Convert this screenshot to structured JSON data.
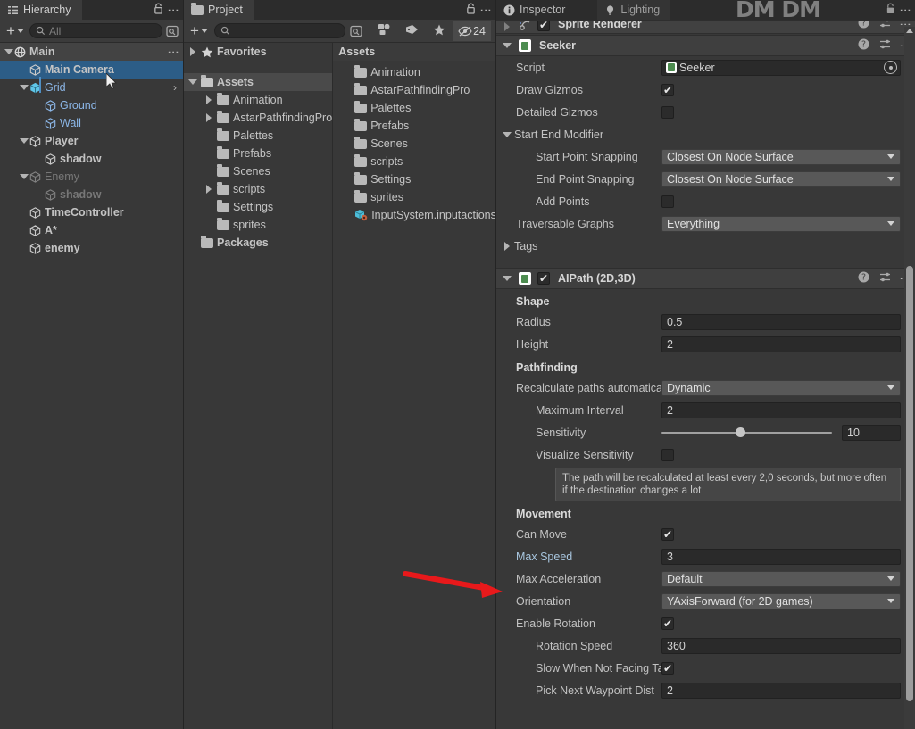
{
  "hierarchy": {
    "tab": {
      "label": "Hierarchy",
      "icon": "hierarchy-icon"
    },
    "toolbar": {
      "add_label": "+",
      "search_placeholder": "All",
      "search_value": ""
    },
    "items": [
      {
        "label": "Main",
        "indent": 0,
        "fold": "open",
        "icon": "scene-icon",
        "state": "scene",
        "selected": false,
        "kebab": true
      },
      {
        "label": "Main Camera",
        "indent": 1,
        "fold": "none",
        "icon": "cube-icon",
        "state": "normal",
        "selected": true,
        "kebab": false
      },
      {
        "label": "Grid",
        "indent": 1,
        "fold": "open",
        "icon": "prefab-icon",
        "state": "prefab",
        "selected": false,
        "kebab": false,
        "chevron": true
      },
      {
        "label": "Ground",
        "indent": 2,
        "fold": "none",
        "icon": "cube-icon",
        "state": "prefab",
        "selected": false,
        "kebab": false
      },
      {
        "label": "Wall",
        "indent": 2,
        "fold": "none",
        "icon": "cube-icon",
        "state": "prefab",
        "selected": false,
        "kebab": false
      },
      {
        "label": "Player",
        "indent": 1,
        "fold": "open",
        "icon": "cube-icon",
        "state": "normal",
        "selected": false,
        "kebab": false
      },
      {
        "label": "shadow",
        "indent": 2,
        "fold": "none",
        "icon": "cube-icon",
        "state": "normal",
        "selected": false,
        "kebab": false
      },
      {
        "label": "Enemy",
        "indent": 1,
        "fold": "open",
        "icon": "cube-icon",
        "state": "inactive",
        "selected": false,
        "kebab": false
      },
      {
        "label": "shadow",
        "indent": 2,
        "fold": "none",
        "icon": "cube-icon",
        "state": "inactive",
        "selected": false,
        "kebab": false
      },
      {
        "label": "TimeController",
        "indent": 1,
        "fold": "none",
        "icon": "cube-icon",
        "state": "normal",
        "selected": false,
        "kebab": false
      },
      {
        "label": "A*",
        "indent": 1,
        "fold": "none",
        "icon": "cube-icon",
        "state": "normal",
        "selected": false,
        "kebab": false
      },
      {
        "label": "enemy",
        "indent": 1,
        "fold": "none",
        "icon": "cube-icon",
        "state": "normal",
        "selected": false,
        "kebab": false
      }
    ]
  },
  "project": {
    "tab": {
      "label": "Project",
      "icon": "folder-icon"
    },
    "toolbar": {
      "add_label": "+",
      "search_placeholder": "",
      "search_value": "",
      "buttons": [
        {
          "name": "asset-filter-icon",
          "label": ""
        },
        {
          "name": "label-filter-icon",
          "label": ""
        },
        {
          "name": "favorite-filter-icon",
          "label": ""
        }
      ],
      "hidden_count": "24",
      "hidden_icon": "eye-off-icon"
    },
    "tree": [
      {
        "label": "Favorites",
        "indent": 0,
        "fold": "closed",
        "icon": "star-icon",
        "bold": true,
        "selected": false
      },
      {
        "label": "",
        "indent": 0,
        "fold": "none",
        "icon": "spacer",
        "bold": false,
        "selected": false
      },
      {
        "label": "Assets",
        "indent": 0,
        "fold": "open",
        "icon": "folder-open-icon",
        "bold": true,
        "selected": true
      },
      {
        "label": "Animation",
        "indent": 1,
        "fold": "closed",
        "icon": "folder-icon",
        "bold": false,
        "selected": false
      },
      {
        "label": "AstarPathfindingPro",
        "indent": 1,
        "fold": "closed",
        "icon": "folder-icon",
        "bold": false,
        "selected": false
      },
      {
        "label": "Palettes",
        "indent": 1,
        "fold": "none",
        "icon": "folder-icon",
        "bold": false,
        "selected": false
      },
      {
        "label": "Prefabs",
        "indent": 1,
        "fold": "none",
        "icon": "folder-icon",
        "bold": false,
        "selected": false
      },
      {
        "label": "Scenes",
        "indent": 1,
        "fold": "none",
        "icon": "folder-icon",
        "bold": false,
        "selected": false
      },
      {
        "label": "scripts",
        "indent": 1,
        "fold": "closed",
        "icon": "folder-icon",
        "bold": false,
        "selected": false
      },
      {
        "label": "Settings",
        "indent": 1,
        "fold": "none",
        "icon": "folder-icon",
        "bold": false,
        "selected": false
      },
      {
        "label": "sprites",
        "indent": 1,
        "fold": "none",
        "icon": "folder-icon",
        "bold": false,
        "selected": false
      },
      {
        "label": "Packages",
        "indent": 0,
        "fold": "none",
        "icon": "folder-icon",
        "bold": true,
        "selected": false
      }
    ],
    "breadcrumb": "Assets",
    "contents": [
      {
        "label": "Animation",
        "icon": "folder-icon"
      },
      {
        "label": "AstarPathfindingPro",
        "icon": "folder-icon"
      },
      {
        "label": "Palettes",
        "icon": "folder-icon"
      },
      {
        "label": "Prefabs",
        "icon": "folder-icon"
      },
      {
        "label": "Scenes",
        "icon": "folder-icon"
      },
      {
        "label": "scripts",
        "icon": "folder-icon"
      },
      {
        "label": "Settings",
        "icon": "folder-icon"
      },
      {
        "label": "sprites",
        "icon": "folder-icon"
      },
      {
        "label": "InputSystem.inputactions",
        "icon": "inputactions-asset-icon"
      }
    ]
  },
  "inspector": {
    "tabs": [
      {
        "label": "Inspector",
        "icon": "info-icon",
        "active": true
      },
      {
        "label": "Lighting",
        "icon": "light-icon",
        "active": false
      }
    ],
    "watermark": "DM DM",
    "clipped_component": {
      "label": "Sprite Renderer",
      "enabled": true
    },
    "components": [
      {
        "name": "seeker-component",
        "title": "Seeker",
        "icon": "script-icon",
        "has_checkbox": false,
        "expanded": true,
        "rows": [
          {
            "kind": "object",
            "label": "Script",
            "value": "Seeker",
            "indent": 0
          },
          {
            "kind": "checkbox",
            "label": "Draw Gizmos",
            "value": true,
            "indent": 0
          },
          {
            "kind": "checkbox",
            "label": "Detailed Gizmos",
            "value": false,
            "indent": 0
          },
          {
            "kind": "foldout",
            "label": "Start End Modifier",
            "value": "open",
            "indent": 0
          },
          {
            "kind": "dropdown",
            "label": "Start Point Snapping",
            "value": "Closest On Node Surface",
            "indent": 1
          },
          {
            "kind": "dropdown",
            "label": "End Point Snapping",
            "value": "Closest On Node Surface",
            "indent": 1
          },
          {
            "kind": "checkbox",
            "label": "Add Points",
            "value": false,
            "indent": 1
          },
          {
            "kind": "dropdown",
            "label": "Traversable Graphs",
            "value": "Everything",
            "indent": 0
          },
          {
            "kind": "foldout",
            "label": "Tags",
            "value": "closed",
            "indent": 0
          }
        ]
      },
      {
        "name": "aipath-component",
        "title": "AIPath (2D,3D)",
        "icon": "script-icon",
        "has_checkbox": true,
        "checkbox_value": true,
        "expanded": true,
        "rows": [
          {
            "kind": "section",
            "label": "Shape"
          },
          {
            "kind": "text",
            "label": "Radius",
            "value": "0.5",
            "indent": 0
          },
          {
            "kind": "text",
            "label": "Height",
            "value": "2",
            "indent": 0
          },
          {
            "kind": "section",
            "label": "Pathfinding"
          },
          {
            "kind": "dropdown",
            "label": "Recalculate paths automatically",
            "value": "Dynamic",
            "indent": 0
          },
          {
            "kind": "text",
            "label": "Maximum Interval",
            "value": "2",
            "indent": 1
          },
          {
            "kind": "slider",
            "label": "Sensitivity",
            "value": "10",
            "indent": 1,
            "fraction": 0.46
          },
          {
            "kind": "checkbox",
            "label": "Visualize Sensitivity",
            "value": false,
            "indent": 1
          },
          {
            "kind": "help",
            "label": "The path will be recalculated at least every 2,0 seconds, but more often if the destination changes a lot"
          },
          {
            "kind": "section",
            "label": "Movement"
          },
          {
            "kind": "checkbox",
            "label": "Can Move",
            "value": true,
            "indent": 0
          },
          {
            "kind": "text",
            "label": "Max Speed",
            "value": "3",
            "indent": 0,
            "highlight": true
          },
          {
            "kind": "dropdown",
            "label": "Max Acceleration",
            "value": "Default",
            "indent": 0
          },
          {
            "kind": "dropdown",
            "label": "Orientation",
            "value": "YAxisForward (for 2D games)",
            "indent": 0
          },
          {
            "kind": "checkbox",
            "label": "Enable Rotation",
            "value": true,
            "indent": 0
          },
          {
            "kind": "text",
            "label": "Rotation Speed",
            "value": "360",
            "indent": 1
          },
          {
            "kind": "checkbox",
            "label": "Slow When Not Facing Target",
            "value": true,
            "indent": 1
          },
          {
            "kind": "text",
            "label": "Pick Next Waypoint Dist",
            "value": "2",
            "indent": 1
          }
        ]
      }
    ]
  },
  "annotation": {
    "name": "red-arrow",
    "color": "#e8191b",
    "points_to": "Max Speed"
  },
  "colors": {
    "panel_bg": "#383838",
    "tab_bg": "#2c2c2c",
    "selection_blue": "#2c5d87",
    "prefab_blue": "#8cb7e8",
    "dropdown_bg": "#585858",
    "field_bg": "#2a2a2a",
    "accent_red": "#e8191b"
  }
}
